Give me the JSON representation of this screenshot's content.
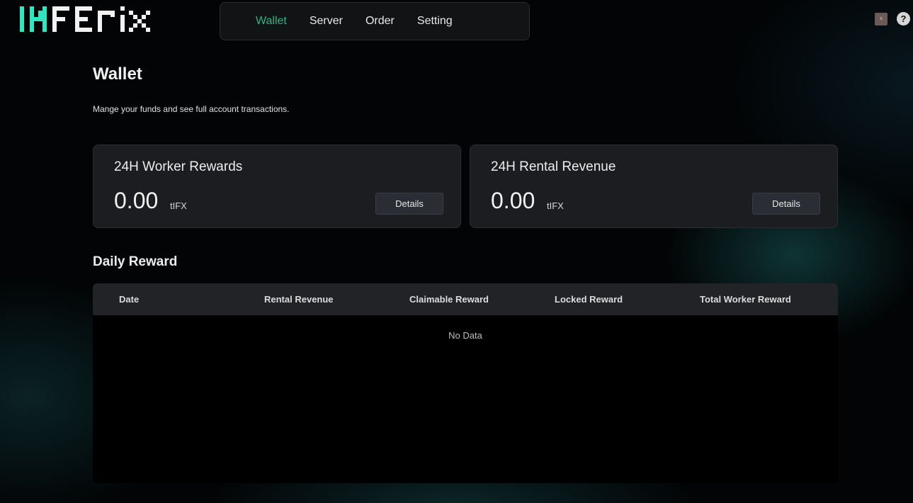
{
  "brand": {
    "logo_text": "INFERIX",
    "accent_color": "#2ee6c0"
  },
  "nav": {
    "items": [
      {
        "label": "Wallet",
        "active": true
      },
      {
        "label": "Server",
        "active": false
      },
      {
        "label": "Order",
        "active": false
      },
      {
        "label": "Setting",
        "active": false
      }
    ],
    "active_color": "#2db584"
  },
  "header": {
    "avatar_initial": "s",
    "help_symbol": "?"
  },
  "page": {
    "title": "Wallet",
    "subtitle": "Mange your funds and see full account transactions."
  },
  "cards": [
    {
      "title": "24H Worker Rewards",
      "value": "0.00",
      "unit": "tIFX",
      "button_label": "Details"
    },
    {
      "title": "24H Rental Revenue",
      "value": "0.00",
      "unit": "tIFX",
      "button_label": "Details"
    }
  ],
  "daily_reward": {
    "title": "Daily Reward",
    "columns": [
      "Date",
      "Rental Revenue",
      "Claimable Reward",
      "Locked Reward",
      "Total Worker Reward"
    ],
    "rows": [],
    "empty_text": "No Data"
  }
}
